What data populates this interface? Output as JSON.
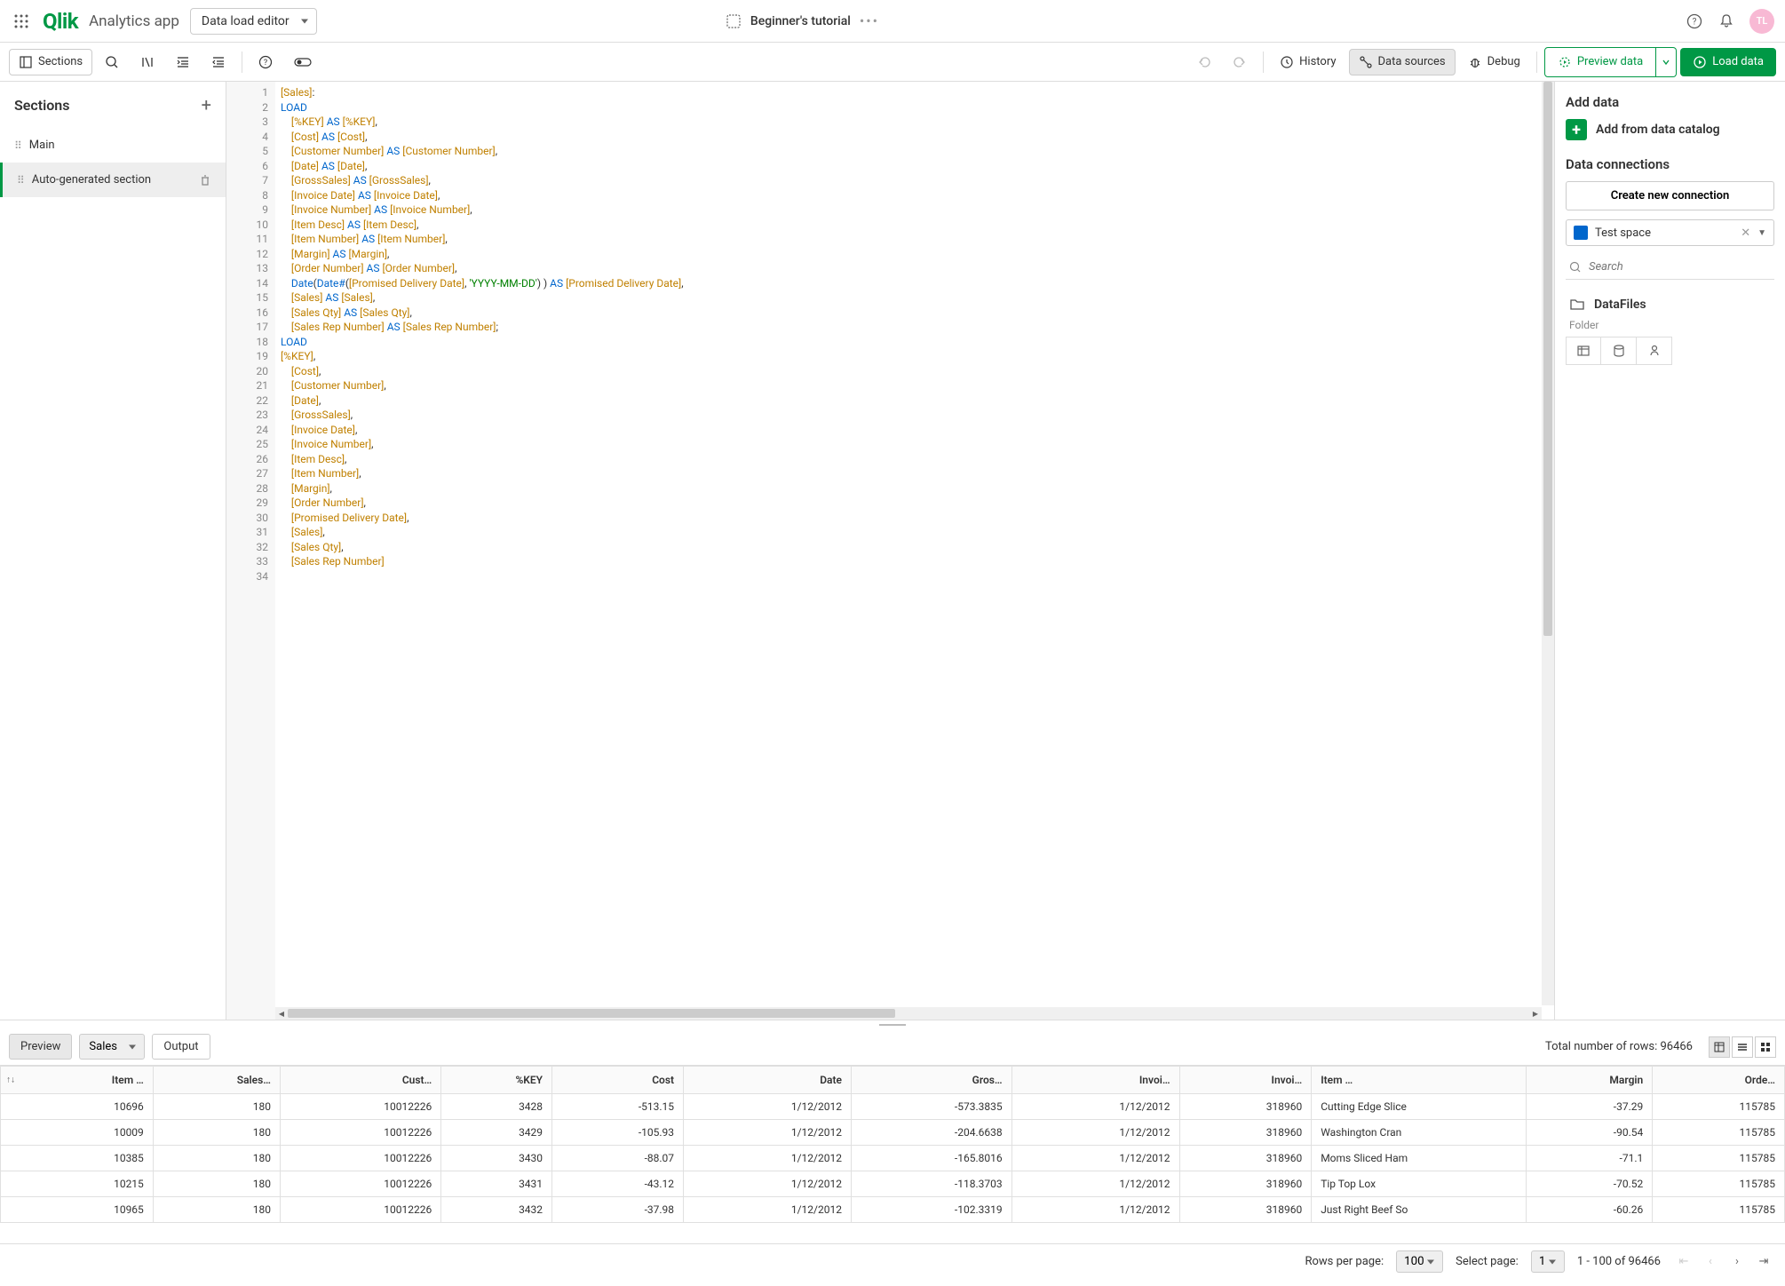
{
  "top": {
    "app_name": "Analytics app",
    "mode": "Data load editor",
    "tutorial": "Beginner's tutorial",
    "avatar": "TL"
  },
  "toolbar": {
    "sections": "Sections",
    "history": "History",
    "data_sources": "Data sources",
    "debug": "Debug",
    "preview_data": "Preview data",
    "load_data": "Load data"
  },
  "left": {
    "title": "Sections",
    "items": [
      "Main",
      "Auto-generated section"
    ],
    "active_index": 1
  },
  "code_lines": [
    [
      [
        "br",
        "[Sales]"
      ],
      [
        "",
        ":"
      ]
    ],
    [
      [
        "kw",
        "LOAD"
      ]
    ],
    [
      [
        "",
        "    "
      ],
      [
        "br",
        "[%KEY]"
      ],
      [
        "",
        " "
      ],
      [
        "kw",
        "AS"
      ],
      [
        "",
        " "
      ],
      [
        "br",
        "[%KEY]"
      ],
      [
        "",
        ","
      ]
    ],
    [
      [
        "",
        "    "
      ],
      [
        "br",
        "[Cost]"
      ],
      [
        "",
        " "
      ],
      [
        "kw",
        "AS"
      ],
      [
        "",
        " "
      ],
      [
        "br",
        "[Cost]"
      ],
      [
        "",
        ","
      ]
    ],
    [
      [
        "",
        "    "
      ],
      [
        "br",
        "[Customer Number]"
      ],
      [
        "",
        " "
      ],
      [
        "kw",
        "AS"
      ],
      [
        "",
        " "
      ],
      [
        "br",
        "[Customer Number]"
      ],
      [
        "",
        ","
      ]
    ],
    [
      [
        "",
        "    "
      ],
      [
        "br",
        "[Date]"
      ],
      [
        "",
        " "
      ],
      [
        "kw",
        "AS"
      ],
      [
        "",
        " "
      ],
      [
        "br",
        "[Date]"
      ],
      [
        "",
        ","
      ]
    ],
    [
      [
        "",
        "    "
      ],
      [
        "br",
        "[GrossSales]"
      ],
      [
        "",
        " "
      ],
      [
        "kw",
        "AS"
      ],
      [
        "",
        " "
      ],
      [
        "br",
        "[GrossSales]"
      ],
      [
        "",
        ","
      ]
    ],
    [
      [
        "",
        "    "
      ],
      [
        "br",
        "[Invoice Date]"
      ],
      [
        "",
        " "
      ],
      [
        "kw",
        "AS"
      ],
      [
        "",
        " "
      ],
      [
        "br",
        "[Invoice Date]"
      ],
      [
        "",
        ","
      ]
    ],
    [
      [
        "",
        "    "
      ],
      [
        "br",
        "[Invoice Number]"
      ],
      [
        "",
        " "
      ],
      [
        "kw",
        "AS"
      ],
      [
        "",
        " "
      ],
      [
        "br",
        "[Invoice Number]"
      ],
      [
        "",
        ","
      ]
    ],
    [
      [
        "",
        "    "
      ],
      [
        "br",
        "[Item Desc]"
      ],
      [
        "",
        " "
      ],
      [
        "kw",
        "AS"
      ],
      [
        "",
        " "
      ],
      [
        "br",
        "[Item Desc]"
      ],
      [
        "",
        ","
      ]
    ],
    [
      [
        "",
        "    "
      ],
      [
        "br",
        "[Item Number]"
      ],
      [
        "",
        " "
      ],
      [
        "kw",
        "AS"
      ],
      [
        "",
        " "
      ],
      [
        "br",
        "[Item Number]"
      ],
      [
        "",
        ","
      ]
    ],
    [
      [
        "",
        "    "
      ],
      [
        "br",
        "[Margin]"
      ],
      [
        "",
        " "
      ],
      [
        "kw",
        "AS"
      ],
      [
        "",
        " "
      ],
      [
        "br",
        "[Margin]"
      ],
      [
        "",
        ","
      ]
    ],
    [
      [
        "",
        "    "
      ],
      [
        "br",
        "[Order Number]"
      ],
      [
        "",
        " "
      ],
      [
        "kw",
        "AS"
      ],
      [
        "",
        " "
      ],
      [
        "br",
        "[Order Number]"
      ],
      [
        "",
        ","
      ]
    ],
    [
      [
        "",
        "    "
      ],
      [
        "fn",
        "Date"
      ],
      [
        "",
        "("
      ],
      [
        "fn",
        "Date#"
      ],
      [
        "",
        "("
      ],
      [
        "br",
        "[Promised Delivery Date]"
      ],
      [
        "",
        ", "
      ],
      [
        "str",
        "'YYYY-MM-DD'"
      ],
      [
        "",
        ") ) "
      ],
      [
        "kw",
        "AS"
      ],
      [
        "",
        " "
      ],
      [
        "br",
        "[Promised Delivery Date]"
      ],
      [
        "",
        ","
      ]
    ],
    [
      [
        "",
        "    "
      ],
      [
        "br",
        "[Sales]"
      ],
      [
        "",
        " "
      ],
      [
        "kw",
        "AS"
      ],
      [
        "",
        " "
      ],
      [
        "br",
        "[Sales]"
      ],
      [
        "",
        ","
      ]
    ],
    [
      [
        "",
        "    "
      ],
      [
        "br",
        "[Sales Qty]"
      ],
      [
        "",
        " "
      ],
      [
        "kw",
        "AS"
      ],
      [
        "",
        " "
      ],
      [
        "br",
        "[Sales Qty]"
      ],
      [
        "",
        ","
      ]
    ],
    [
      [
        "",
        "    "
      ],
      [
        "br",
        "[Sales Rep Number]"
      ],
      [
        "",
        " "
      ],
      [
        "kw",
        "AS"
      ],
      [
        "",
        " "
      ],
      [
        "br",
        "[Sales Rep Number]"
      ],
      [
        "",
        ";"
      ]
    ],
    [
      [
        "kw",
        "LOAD"
      ]
    ],
    [
      [
        "br",
        "[%KEY]"
      ],
      [
        "",
        ","
      ]
    ],
    [
      [
        "",
        "    "
      ],
      [
        "br",
        "[Cost]"
      ],
      [
        "",
        ","
      ]
    ],
    [
      [
        "",
        "    "
      ],
      [
        "br",
        "[Customer Number]"
      ],
      [
        "",
        ","
      ]
    ],
    [
      [
        "",
        "    "
      ],
      [
        "br",
        "[Date]"
      ],
      [
        "",
        ","
      ]
    ],
    [
      [
        "",
        "    "
      ],
      [
        "br",
        "[GrossSales]"
      ],
      [
        "",
        ","
      ]
    ],
    [
      [
        "",
        "    "
      ],
      [
        "br",
        "[Invoice Date]"
      ],
      [
        "",
        ","
      ]
    ],
    [
      [
        "",
        "    "
      ],
      [
        "br",
        "[Invoice Number]"
      ],
      [
        "",
        ","
      ]
    ],
    [
      [
        "",
        "    "
      ],
      [
        "br",
        "[Item Desc]"
      ],
      [
        "",
        ","
      ]
    ],
    [
      [
        "",
        "    "
      ],
      [
        "br",
        "[Item Number]"
      ],
      [
        "",
        ","
      ]
    ],
    [
      [
        "",
        "    "
      ],
      [
        "br",
        "[Margin]"
      ],
      [
        "",
        ","
      ]
    ],
    [
      [
        "",
        "    "
      ],
      [
        "br",
        "[Order Number]"
      ],
      [
        "",
        ","
      ]
    ],
    [
      [
        "",
        "    "
      ],
      [
        "br",
        "[Promised Delivery Date]"
      ],
      [
        "",
        ","
      ]
    ],
    [
      [
        "",
        "    "
      ],
      [
        "br",
        "[Sales]"
      ],
      [
        "",
        ","
      ]
    ],
    [
      [
        "",
        "    "
      ],
      [
        "br",
        "[Sales Qty]"
      ],
      [
        "",
        ","
      ]
    ],
    [
      [
        "",
        "    "
      ],
      [
        "br",
        "[Sales Rep Number]"
      ]
    ],
    [
      [
        "",
        ""
      ]
    ]
  ],
  "right": {
    "add_data_title": "Add data",
    "add_catalog": "Add from data catalog",
    "data_connections_title": "Data connections",
    "create_conn": "Create new connection",
    "space": "Test space",
    "search_placeholder": "Search",
    "conn_name": "DataFiles",
    "conn_type": "Folder"
  },
  "preview": {
    "tab_preview": "Preview",
    "tab_output": "Output",
    "table": "Sales",
    "total_rows": "Total number of rows: 96466",
    "columns": [
      "Item …",
      "Sales…",
      "Cust…",
      "%KEY",
      "Cost",
      "Date",
      "Gros…",
      "Invoi…",
      "Invoi…",
      "Item …",
      "Margin",
      "Orde…"
    ],
    "col_align": [
      "r",
      "r",
      "r",
      "r",
      "r",
      "r",
      "r",
      "r",
      "r",
      "l",
      "r",
      "r"
    ],
    "rows": [
      [
        "10696",
        "180",
        "10012226",
        "3428",
        "-513.15",
        "1/12/2012",
        "-573.3835",
        "1/12/2012",
        "318960",
        "Cutting Edge Slice",
        "-37.29",
        "115785"
      ],
      [
        "10009",
        "180",
        "10012226",
        "3429",
        "-105.93",
        "1/12/2012",
        "-204.6638",
        "1/12/2012",
        "318960",
        "Washington Cran",
        "-90.54",
        "115785"
      ],
      [
        "10385",
        "180",
        "10012226",
        "3430",
        "-88.07",
        "1/12/2012",
        "-165.8016",
        "1/12/2012",
        "318960",
        "Moms Sliced Ham",
        "-71.1",
        "115785"
      ],
      [
        "10215",
        "180",
        "10012226",
        "3431",
        "-43.12",
        "1/12/2012",
        "-118.3703",
        "1/12/2012",
        "318960",
        "Tip Top Lox",
        "-70.52",
        "115785"
      ],
      [
        "10965",
        "180",
        "10012226",
        "3432",
        "-37.98",
        "1/12/2012",
        "-102.3319",
        "1/12/2012",
        "318960",
        "Just Right Beef So",
        "-60.26",
        "115785"
      ]
    ]
  },
  "pager": {
    "rows_per_page_label": "Rows per page:",
    "rows_per_page": "100",
    "select_page_label": "Select page:",
    "select_page": "1",
    "range": "1 - 100 of 96466"
  }
}
